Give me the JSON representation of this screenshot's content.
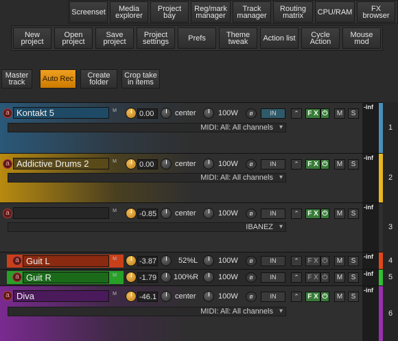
{
  "toolbar_top": [
    "Screenset",
    "Media\nexplorer",
    "Project\nbay",
    "Reg/mark\nmanager",
    "Track\nmanager",
    "Routing\nmatrix",
    "CPU/RAM",
    "FX\nbrowser"
  ],
  "toolbar_mid": [
    "New\nproject",
    "Open\nproject",
    "Save\nproject",
    "Project\nsettings",
    "Prefs",
    "Theme\ntweak",
    "Action list",
    "Cycle\nAction",
    "Mouse\nmod"
  ],
  "toolbar_left": [
    "Master\ntrack",
    "Auto Rec",
    "Create\nfolder",
    "Crop take\nin items"
  ],
  "tracks": [
    {
      "number": "1",
      "name": "Kontakt 5",
      "volume": "0.00",
      "pan": "center",
      "width": "100W",
      "input": "MIDI: All: All channels",
      "meter": "-inf",
      "color": "#4a8fb8"
    },
    {
      "number": "2",
      "name": "Addictive Drums 2",
      "volume": "0.00",
      "pan": "center",
      "width": "100W",
      "input": "MIDI: All: All channels",
      "meter": "-inf",
      "color": "#e8b820"
    },
    {
      "number": "3",
      "name": "",
      "volume": "-0.85",
      "pan": "center",
      "width": "100W",
      "input": "IBANEZ",
      "meter": "-inf",
      "color": "#3a3a3a"
    },
    {
      "number": "4",
      "name": "Guit L",
      "volume": "-3.87",
      "pan": "52%L",
      "width": "100W",
      "input": "",
      "meter": "-inf",
      "color": "#e04818"
    },
    {
      "number": "5",
      "name": "Guit R",
      "volume": "-1.79",
      "pan": "100%R",
      "width": "100W",
      "input": "",
      "meter": "-inf",
      "color": "#30c030"
    },
    {
      "number": "6",
      "name": "Diva",
      "volume": "-46.1",
      "pan": "center",
      "width": "100W",
      "input": "MIDI: All: All channels",
      "meter": "-inf",
      "color": "#9a2fb0"
    }
  ],
  "labels": {
    "m": "M",
    "s": "S",
    "fx": "F X",
    "in": "IN",
    "mtag": "M"
  }
}
